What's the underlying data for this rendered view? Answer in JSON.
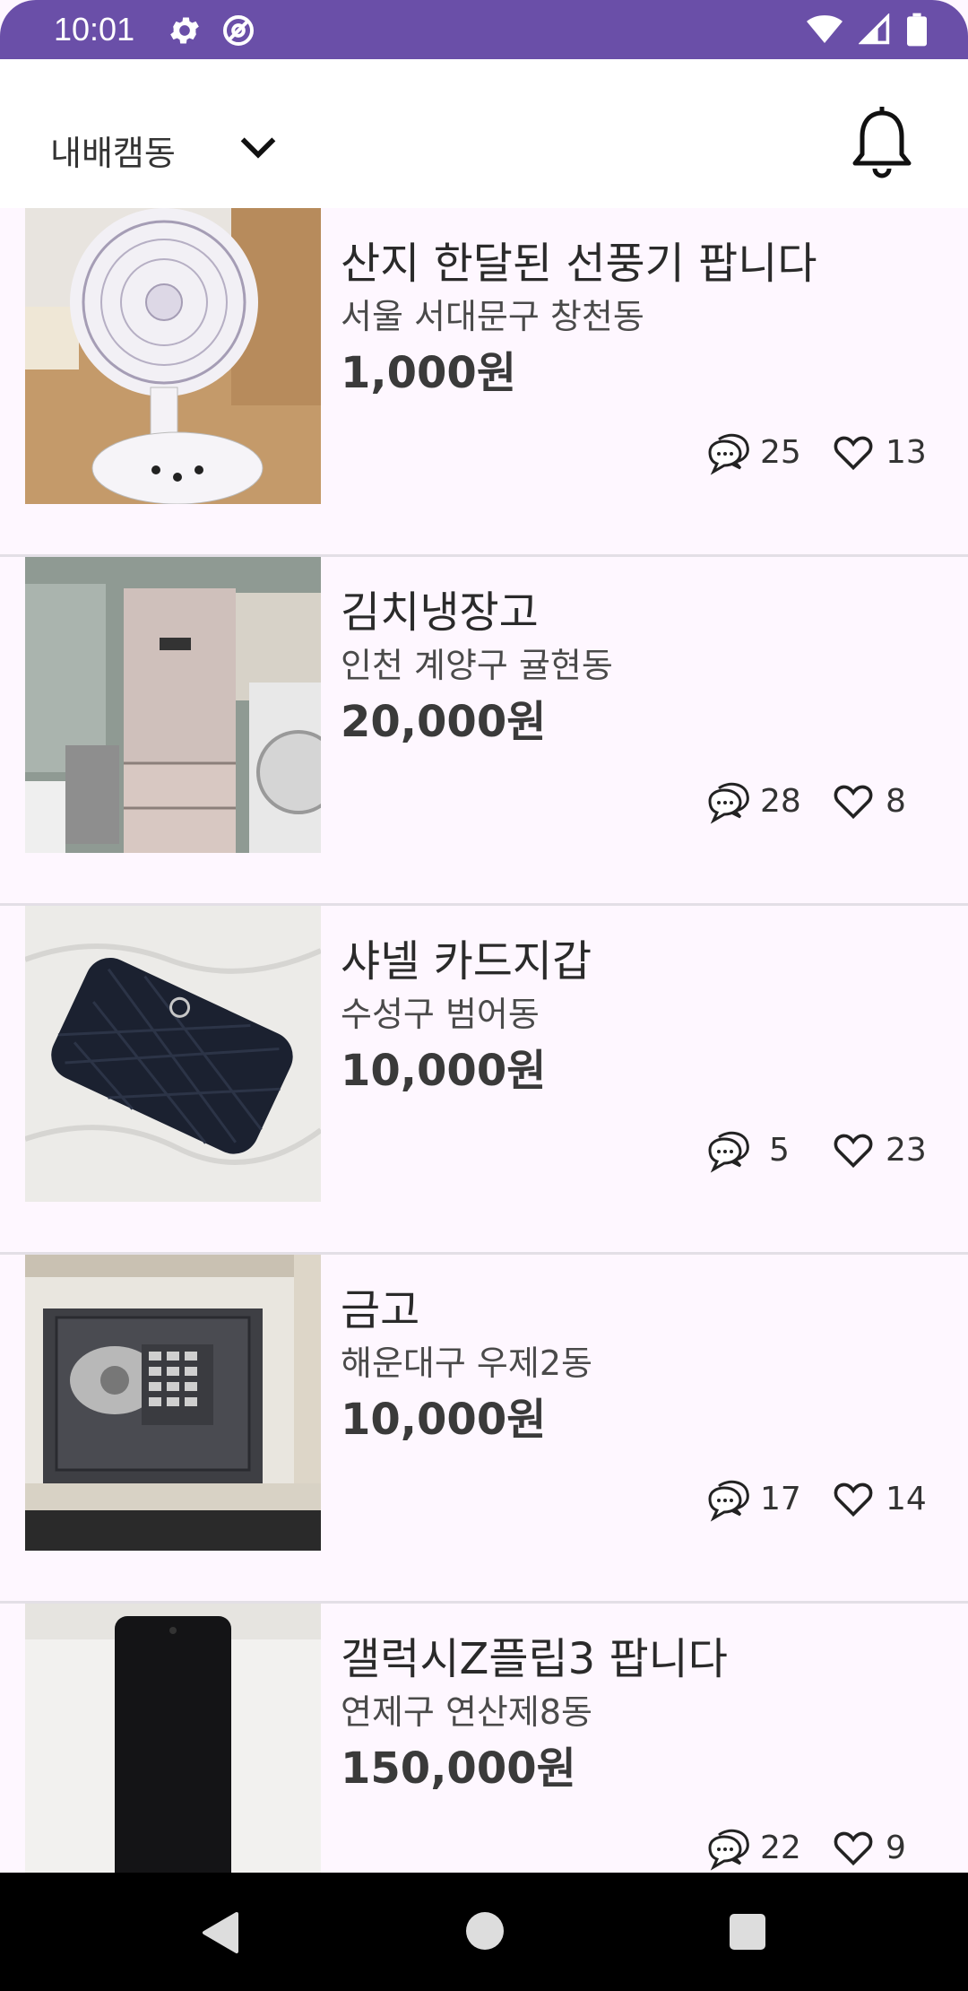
{
  "status_bar": {
    "time": "10:01",
    "left_icons": [
      "gear-icon",
      "at-sign-icon"
    ],
    "right_icons": [
      "wifi-icon",
      "signal-icon",
      "battery-icon"
    ],
    "color": "#6A4FA8"
  },
  "header": {
    "location": "내배캠동",
    "dropdown_icon": "chevron-down-icon",
    "bell_icon": "bell-icon"
  },
  "items": [
    {
      "title": "산지 한달된 선풍기 팝니다",
      "location": "서울 서대문구 창천동",
      "price": "1,000원",
      "chats": "25",
      "likes": "13",
      "image": "electric fan"
    },
    {
      "title": "김치냉장고",
      "location": "인천 계양구 귤현동",
      "price": "20,000원",
      "chats": "28",
      "likes": "8",
      "image": "kimchi refrigerator"
    },
    {
      "title": "샤넬 카드지갑",
      "location": "수성구 범어동",
      "price": "10,000원",
      "chats": "5",
      "likes": "23",
      "image": "card wallet"
    },
    {
      "title": "금고",
      "location": "해운대구 우제2동",
      "price": "10,000원",
      "chats": "17",
      "likes": "14",
      "image": "safe"
    },
    {
      "title": "갤럭시Z플립3 팝니다",
      "location": "연제구 연산제8동",
      "price": "150,000원",
      "chats": "22",
      "likes": "9",
      "image": "phone"
    }
  ],
  "nav_bar": {
    "back_icon": "back-triangle-icon",
    "home_icon": "home-circle-icon",
    "recents_icon": "recents-square-icon"
  }
}
